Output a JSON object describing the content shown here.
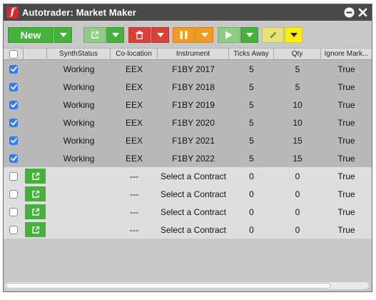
{
  "window": {
    "title": "Autotrader: Market Maker",
    "logo_letter": "f"
  },
  "toolbar": {
    "new_label": "New"
  },
  "grid": {
    "columns": [
      "",
      "",
      "SynthStatus",
      "Co-location",
      "Instrument",
      "Ticks Away",
      "Qty",
      "Ignore Mark..."
    ],
    "rows": [
      {
        "checked": true,
        "status": "Working",
        "colocation": "EEX",
        "instrument": "F1BY 2017",
        "ticks_away": "5",
        "qty": "5",
        "ignore_market": "True"
      },
      {
        "checked": true,
        "status": "Working",
        "colocation": "EEX",
        "instrument": "F1BY 2018",
        "ticks_away": "5",
        "qty": "5",
        "ignore_market": "True"
      },
      {
        "checked": true,
        "status": "Working",
        "colocation": "EEX",
        "instrument": "F1BY 2019",
        "ticks_away": "5",
        "qty": "10",
        "ignore_market": "True"
      },
      {
        "checked": true,
        "status": "Working",
        "colocation": "EEX",
        "instrument": "F1BY 2020",
        "ticks_away": "5",
        "qty": "10",
        "ignore_market": "True"
      },
      {
        "checked": true,
        "status": "Working",
        "colocation": "EEX",
        "instrument": "F1BY 2021",
        "ticks_away": "5",
        "qty": "15",
        "ignore_market": "True"
      },
      {
        "checked": true,
        "status": "Working",
        "colocation": "EEX",
        "instrument": "F1BY 2022",
        "ticks_away": "5",
        "qty": "15",
        "ignore_market": "True"
      },
      {
        "checked": false,
        "status": "",
        "colocation": "---",
        "instrument": "Select a Contract",
        "ticks_away": "0",
        "qty": "0",
        "ignore_market": "True"
      },
      {
        "checked": false,
        "status": "",
        "colocation": "---",
        "instrument": "Select a Contract",
        "ticks_away": "0",
        "qty": "0",
        "ignore_market": "True"
      },
      {
        "checked": false,
        "status": "",
        "colocation": "---",
        "instrument": "Select a Contract",
        "ticks_away": "0",
        "qty": "0",
        "ignore_market": "True"
      },
      {
        "checked": false,
        "status": "",
        "colocation": "---",
        "instrument": "Select a Contract",
        "ticks_away": "0",
        "qty": "0",
        "ignore_market": "True"
      }
    ]
  },
  "colors": {
    "title_bar": "#494949",
    "green": "#45b23a",
    "red": "#d9403a",
    "orange": "#f39b1e",
    "yellow": "#fff000",
    "checkbox_blue": "#2e7cf6"
  },
  "icons": {
    "new_dropdown": "chevron-down-icon",
    "export": "external-link-icon",
    "delete": "trash-icon",
    "pause": "pause-icon",
    "start": "play-icon",
    "edit": "pencil-icon",
    "minimize": "minimize-icon",
    "close": "close-icon"
  }
}
